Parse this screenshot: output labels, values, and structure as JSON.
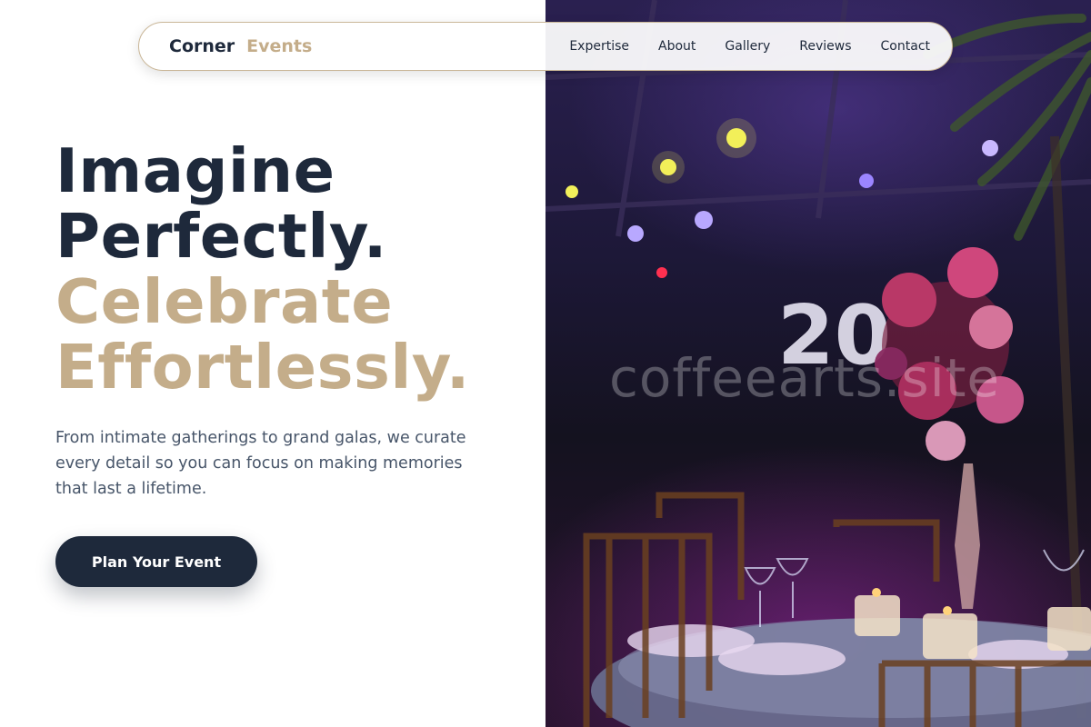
{
  "brand": {
    "part1": "Corner",
    "part2": "Events"
  },
  "nav": {
    "links": [
      "Expertise",
      "About",
      "Gallery",
      "Reviews",
      "Contact"
    ]
  },
  "hero": {
    "line1": "Imagine",
    "line2": "Perfectly.",
    "line3": "Celebrate",
    "line4": "Effortlessly.",
    "subtext": "From intimate gatherings to grand galas, we curate every detail so you can focus on making memories that last a lifetime.",
    "cta_label": "Plan Your Event"
  },
  "image": {
    "watermark": "coffeearts.site"
  },
  "colors": {
    "navy": "#1e293b",
    "gold": "#c4ad8a",
    "body_text": "#475569"
  }
}
